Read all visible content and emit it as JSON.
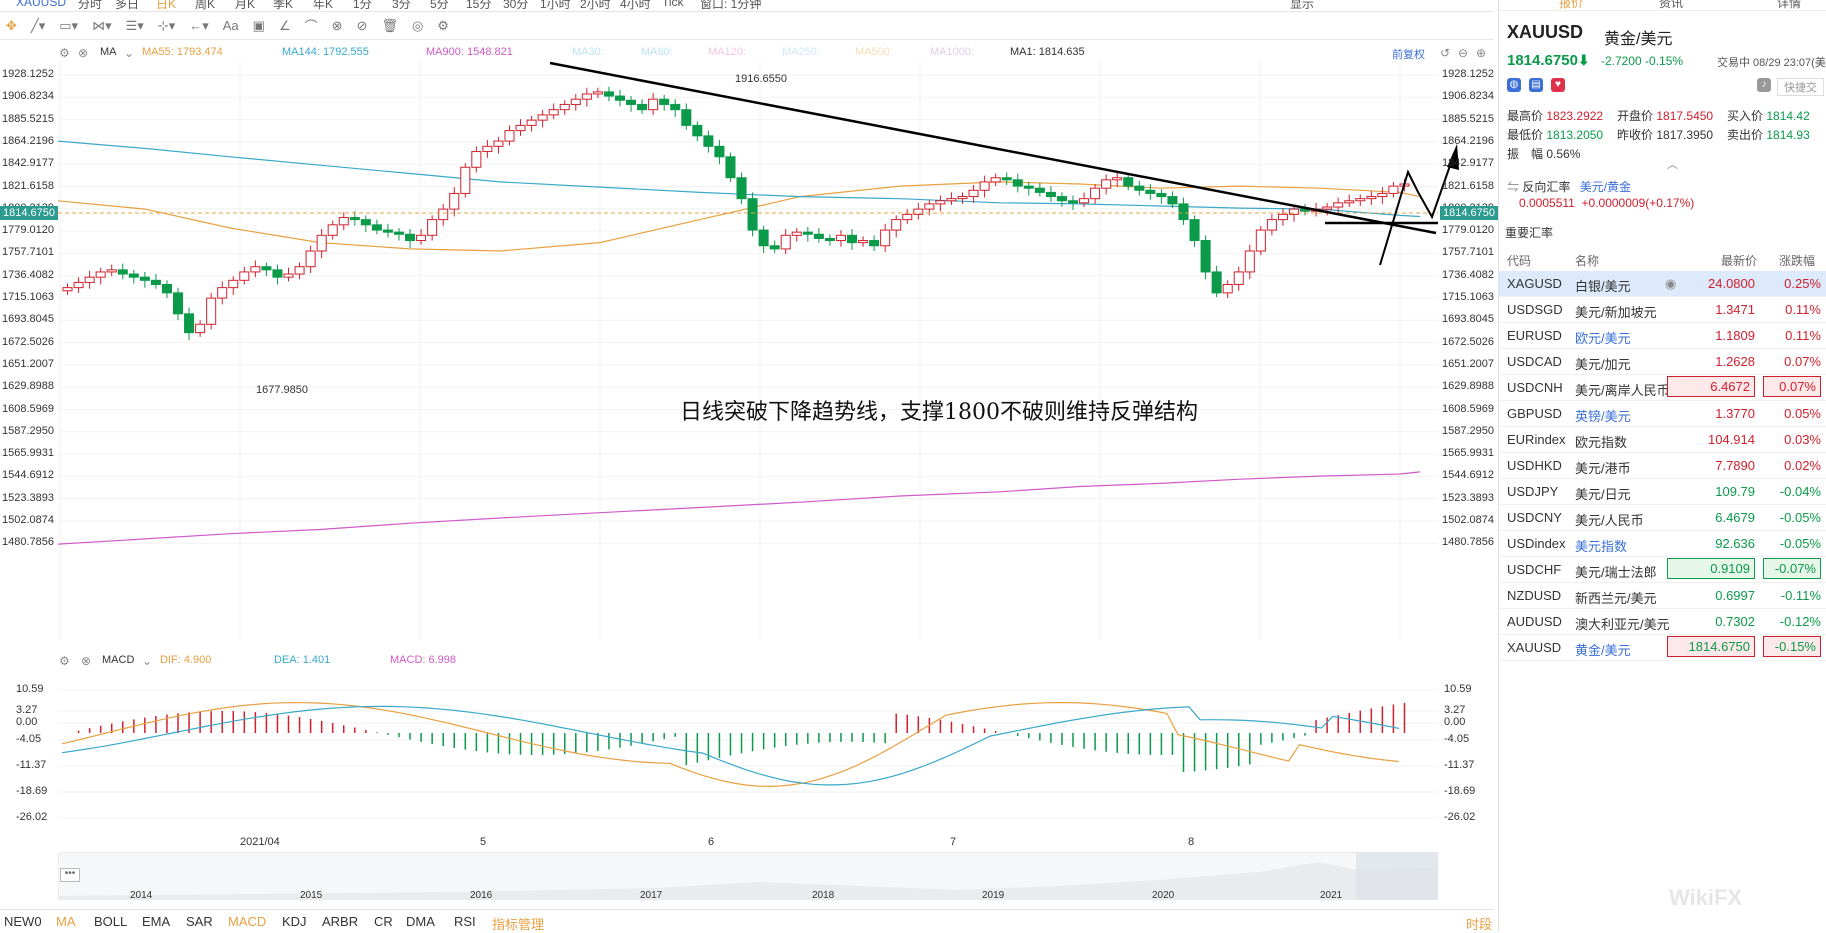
{
  "topbar": {
    "symbol": "XAUUSD",
    "items": [
      "分时",
      "多日",
      "日K",
      "周K",
      "月K",
      "季K",
      "年K",
      "1分",
      "3分",
      "5分",
      "15分",
      "30分",
      "1小时",
      "2小时",
      "4小时",
      "Tick",
      "窗口: 1分钟"
    ],
    "right": "显示"
  },
  "toolbar": {
    "icons": [
      "crosshair-icon",
      "line-icon",
      "rect-icon",
      "fork-icon",
      "fib-icon",
      "measure-icon",
      "arrow-icon",
      "text-icon",
      "note-icon",
      "ruler-icon",
      "arc-icon",
      "magnet-icon",
      "hide-icon",
      "trash-icon",
      "eye-icon",
      "settings-icon"
    ],
    "text_label": "Aa"
  },
  "ma_legend": {
    "name": "MA",
    "items": [
      {
        "label": "MA55: 1793.474",
        "color": "#e8a040",
        "arrow": "▾"
      },
      {
        "label": "MA144: 1792.555",
        "color": "#3aa9c9",
        "arrow": "▾"
      },
      {
        "label": "MA900: 1548.821",
        "color": "#d05ac8",
        "arrow": "▴"
      },
      {
        "label": "MA30:",
        "color": "#bde3f0",
        "arrow": ""
      },
      {
        "label": "MA60:",
        "color": "#bde3f0",
        "arrow": ""
      },
      {
        "label": "MA120:",
        "color": "#f6c6de",
        "arrow": ""
      },
      {
        "label": "MA250:",
        "color": "#cde9f5",
        "arrow": ""
      },
      {
        "label": "MA500:",
        "color": "#f6ddb8",
        "arrow": ""
      },
      {
        "label": "MA1000:",
        "color": "#e4cde9",
        "arrow": ""
      },
      {
        "label": "MA1: 1814.635",
        "color": "#333333",
        "arrow": "▾"
      }
    ],
    "adjust": "前复权"
  },
  "price_axis": [
    "1928.1252",
    "1906.8234",
    "1885.5215",
    "1864.2196",
    "1842.9177",
    "1821.6158",
    "1800.3139",
    "1779.0120",
    "1757.7101",
    "1736.4082",
    "1715.1063",
    "1693.8045",
    "1672.5026",
    "1651.2007",
    "1629.8988",
    "1608.5969",
    "1587.2950",
    "1565.9931",
    "1544.6912",
    "1523.3893",
    "1502.0874",
    "1480.7856"
  ],
  "current_price_tag": "1814.6750",
  "high_label": "1916.6550",
  "low_label": "1677.9850",
  "annotation": "日线突破下降趋势线，支撑1800不破则维持反弹结构",
  "macd_legend": {
    "name": "MACD",
    "dif": "DIF: 4.900",
    "dea": "DEA: 1.401",
    "macd": "MACD: 6.998"
  },
  "macd_axis": [
    "10.59",
    "3.27",
    "0.00",
    "-4.05",
    "-11.37",
    "-18.69",
    "-26.02"
  ],
  "time_axis": [
    "2021/04",
    "5",
    "6",
    "7",
    "8"
  ],
  "overview_axis": [
    "2014",
    "2015",
    "2016",
    "2017",
    "2018",
    "2019",
    "2020",
    "2021"
  ],
  "bottom_tabs": [
    "NEW0",
    "MA",
    "BOLL",
    "EMA",
    "SAR",
    "MACD",
    "KDJ",
    "ARBR",
    "CR",
    "DMA",
    "RSI",
    "指标管理"
  ],
  "bottom_right": "时段",
  "panel": {
    "tabs": [
      "报价",
      "资讯",
      "详情"
    ],
    "symbol": "XAUUSD",
    "name": "黄金/美元",
    "price": "1814.6750",
    "arrow": "⬇",
    "change": "-2.7200",
    "change_pct": "-0.15%",
    "status": "交易中 08/29 23:07(美",
    "quick": "快捷交",
    "stats": {
      "high_label": "最高价",
      "high": "1823.2922",
      "open_label": "开盘价",
      "open": "1817.5450",
      "buy_label": "买入价",
      "buy": "1814.42",
      "low_label": "最低价",
      "low": "1813.2050",
      "prev_label": "昨收价",
      "prev": "1817.3950",
      "sell_label": "卖出价",
      "sell": "1814.93",
      "amp_label": "振　幅",
      "amp": "0.56%"
    },
    "reverse": {
      "label": "反向汇率",
      "pair": "美元/黄金",
      "value": "0.0005511",
      "change": "+0.0000009(+0.17%)"
    },
    "section": "重要汇率",
    "headers": [
      "代码",
      "名称",
      "最新价",
      "涨跌幅"
    ],
    "rates": [
      {
        "code": "XAGUSD",
        "name": "白银/美元",
        "price": "24.0800",
        "pct": "0.25%",
        "dir": "up",
        "hl": "sel"
      },
      {
        "code": "USDSGD",
        "name": "美元/新加坡元",
        "price": "1.3471",
        "pct": "0.11%",
        "dir": "up",
        "hl": ""
      },
      {
        "code": "EURUSD",
        "name": "欧元/美元",
        "price": "1.1809",
        "pct": "0.11%",
        "dir": "up",
        "hl": ""
      },
      {
        "code": "USDCAD",
        "name": "美元/加元",
        "price": "1.2628",
        "pct": "0.07%",
        "dir": "up",
        "hl": ""
      },
      {
        "code": "USDCNH",
        "name": "美元/离岸人民币",
        "price": "6.4672",
        "pct": "0.07%",
        "dir": "up",
        "hl": "red"
      },
      {
        "code": "GBPUSD",
        "name": "英镑/美元",
        "price": "1.3770",
        "pct": "0.05%",
        "dir": "up",
        "hl": ""
      },
      {
        "code": "EURindex",
        "name": "欧元指数",
        "price": "104.914",
        "pct": "0.03%",
        "dir": "up",
        "hl": ""
      },
      {
        "code": "USDHKD",
        "name": "美元/港币",
        "price": "7.7890",
        "pct": "0.02%",
        "dir": "up",
        "hl": ""
      },
      {
        "code": "USDJPY",
        "name": "美元/日元",
        "price": "109.79",
        "pct": "-0.04%",
        "dir": "down",
        "hl": ""
      },
      {
        "code": "USDCNY",
        "name": "美元/人民币",
        "price": "6.4679",
        "pct": "-0.05%",
        "dir": "down",
        "hl": ""
      },
      {
        "code": "USDindex",
        "name": "美元指数",
        "price": "92.636",
        "pct": "-0.05%",
        "dir": "down",
        "hl": ""
      },
      {
        "code": "USDCHF",
        "name": "美元/瑞士法郎",
        "price": "0.9109",
        "pct": "-0.07%",
        "dir": "down",
        "hl": "green"
      },
      {
        "code": "NZDUSD",
        "name": "新西兰元/美元",
        "price": "0.6997",
        "pct": "-0.11%",
        "dir": "down",
        "hl": ""
      },
      {
        "code": "AUDUSD",
        "name": "澳大利亚元/美元",
        "price": "0.7302",
        "pct": "-0.12%",
        "dir": "down",
        "hl": ""
      },
      {
        "code": "XAUUSD",
        "name": "黄金/美元",
        "price": "1814.6750",
        "pct": "-0.15%",
        "dir": "down",
        "hl": "red"
      }
    ],
    "watermark": "WikiFX"
  },
  "colors": {
    "up": "#d0202d",
    "down": "#0a9a4a",
    "ma55": "#e8a040",
    "ma144": "#3aa9c9",
    "ma900": "#d05ac8",
    "trend": "#000000"
  },
  "chart_data": {
    "type": "candlestick",
    "title": "",
    "ylim": [
      1470,
      1935
    ],
    "series": [
      {
        "name": "MA55",
        "values_approx": [
          1808,
          1800,
          1782,
          1768,
          1762,
          1760,
          1768,
          1790,
          1812,
          1822,
          1826,
          1824,
          1820,
          1822,
          1820,
          1816,
          1812
        ]
      },
      {
        "name": "MA144",
        "values_approx": [
          1865,
          1858,
          1850,
          1842,
          1834,
          1826,
          1821,
          1816,
          1812,
          1810,
          1806,
          1805,
          1803,
          1801,
          1800,
          1794,
          1793
        ]
      },
      {
        "name": "MA900",
        "values_approx": [
          1480,
          1485,
          1490,
          1494,
          1500,
          1505,
          1510,
          1515,
          1520,
          1526,
          1530,
          1535,
          1538,
          1542,
          1545,
          1547,
          1549
        ]
      }
    ],
    "macd_ylim": [
      -27,
      12
    ]
  }
}
